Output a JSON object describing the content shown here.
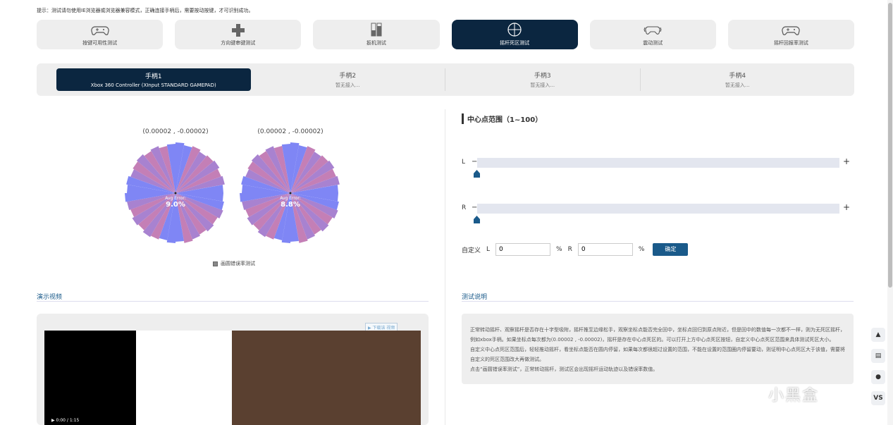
{
  "tip": "提示：测试请勿使用IE浏览器或浏览器兼容模式，正确连接手柄后，需要按动按键，才可识别成功。",
  "tabs": [
    {
      "label": "按键可用性测试",
      "icon": "gamepad-icon"
    },
    {
      "label": "方向键串键测试",
      "icon": "dpad-icon"
    },
    {
      "label": "扳机测试",
      "icon": "trigger-icon"
    },
    {
      "label": "摇杆死区测试",
      "icon": "crosshair-icon"
    },
    {
      "label": "震动测试",
      "icon": "vibration-icon"
    },
    {
      "label": "摇杆回报率测试",
      "icon": "gamepad-icon"
    }
  ],
  "pads": [
    {
      "title": "手柄1",
      "sub": "Xbox 360 Controller (XInput STANDARD GAMEPAD)"
    },
    {
      "title": "手柄2",
      "sub": "暂无接入..."
    },
    {
      "title": "手柄3",
      "sub": "暂无接入..."
    },
    {
      "title": "手柄4",
      "sub": "暂无接入..."
    }
  ],
  "sticks": [
    {
      "coord": "(0.00002 , -0.00002)",
      "err_label": "Avg Error:",
      "err_value": "9.0%"
    },
    {
      "coord": "(0.00002 , -0.00002)",
      "err_label": "Avg Error:",
      "err_value": "8.8%"
    }
  ],
  "checkbox_label": "画圆错误率测试",
  "range": {
    "title": "中心点范围（1~100）",
    "l_label": "L",
    "r_label": "R",
    "minus": "−",
    "plus": "+",
    "l_value": 0.0,
    "r_value": 0.0
  },
  "custom": {
    "label": "自定义",
    "l_label": "L",
    "l_value": "0",
    "r_label": "R",
    "r_value": "0",
    "percent": "%",
    "confirm": "确定"
  },
  "demo_title": "演示视频",
  "demo_tag": "▶ 下载该 视频",
  "video_time": "▶  0:00 / 1:15",
  "desc_title": "测试说明",
  "desc_lines": [
    "正常转动摇杆、观察摇杆是否存在十字型吸附，摇杆推至边缘松手，观察坐标点能否完全回中，坐标点回归到原点附近，但是回中的数值每一次都不一样，则为无死区摇杆，",
    "例如xbox手柄。如果坐标点每次都为(0.00002 , -0.00002)，摇杆是存在中心点死区的。可以打开上方中心点死区按钮，自定义中心点死区范围来具体测试死区大小。",
    "自定义中心点死区范围后，轻轻推动摇杆，看坐标点能否在圆内停留，如果每次都很超过设置的范围，不能在设置的范围圈内停留要动，则证明中心点死区大于该值，需要将",
    "自定义的死区范围改大再做测试。",
    "点击“画圆错误率测试”，正常转动摇杆，测试区会出现摇杆运动轨迹以及错误率数值。"
  ],
  "side_buttons": [
    "rocket-icon",
    "clipboard-icon",
    "chat-icon",
    "VS"
  ],
  "watermark": "小黑盒"
}
